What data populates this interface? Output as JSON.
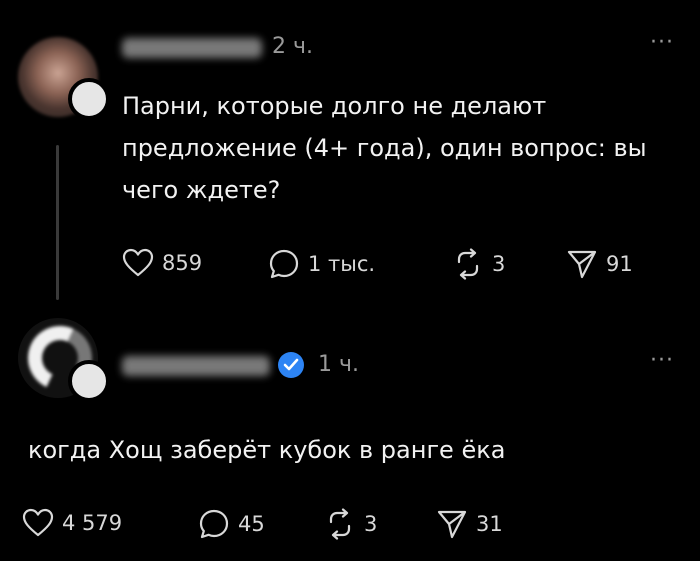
{
  "post": {
    "time": "2 ч.",
    "more": "···",
    "text": "Парни, которые долго не делают предложение (4+ года), один вопрос: вы чего ждете?",
    "likes": "859",
    "comments": "1 тыс.",
    "reposts": "3",
    "shares": "91"
  },
  "reply": {
    "time": "1 ч.",
    "more": "···",
    "text": "когда Хощ заберёт кубок в ранге ёка",
    "likes": "4 579",
    "comments": "45",
    "reposts": "3",
    "shares": "31"
  },
  "colors": {
    "background": "#000000",
    "text": "#f2f2f2",
    "muted": "#9a9a9a",
    "verified": "#2d84f4"
  },
  "icons": [
    "heart-icon",
    "comment-icon",
    "repost-icon",
    "share-icon",
    "verified-icon",
    "more-icon"
  ]
}
